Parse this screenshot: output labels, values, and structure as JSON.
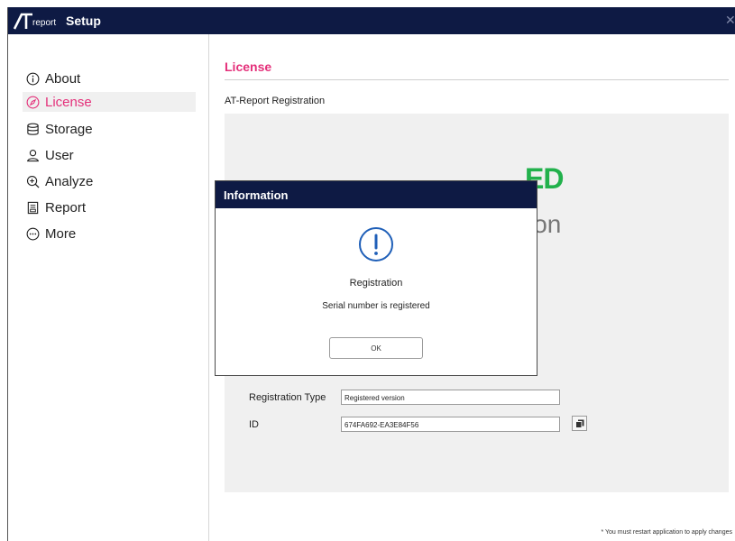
{
  "window": {
    "logo_text": "report",
    "title": "Setup",
    "close_glyph": "✕"
  },
  "sidebar": {
    "items": [
      {
        "label": "About",
        "icon": "info-icon"
      },
      {
        "label": "License",
        "icon": "compass-icon",
        "active": true
      },
      {
        "label": "Storage",
        "icon": "database-icon"
      },
      {
        "label": "User",
        "icon": "user-icon"
      },
      {
        "label": "Analyze",
        "icon": "zoom-icon"
      },
      {
        "label": "Report",
        "icon": "report-icon"
      },
      {
        "label": "More",
        "icon": "more-icon"
      }
    ]
  },
  "content": {
    "section_title": "License",
    "subheading": "AT-Report Registration",
    "banner_partial": "ED",
    "banner_sub_partial": "ion",
    "registration_type_label": "Registration Type",
    "registration_type_value": "Registered version",
    "id_label": "ID",
    "id_value": "674FA692-EA3E84F56",
    "footnote": "* You must restart application to apply changes"
  },
  "dialog": {
    "title": "Information",
    "heading": "Registration",
    "message": "Serial number is registered",
    "ok_label": "OK"
  },
  "colors": {
    "titlebar": "#0e1a44",
    "accent": "#e4307a",
    "registered_green": "#22b14c",
    "info_blue": "#1f5fb8"
  }
}
